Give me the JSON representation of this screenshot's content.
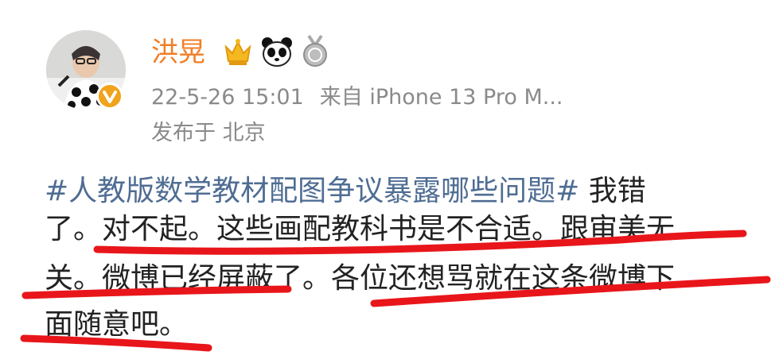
{
  "post": {
    "username": "洪晃",
    "badges": [
      "crown-badge",
      "panda-badge",
      "medal-badge"
    ],
    "timestamp": "22-5-26 15:01",
    "source": "来自 iPhone 13 Pro M...",
    "location": "发布于 北京",
    "hashtag": "#人教版数学教材配图争议暴露哪些问题#",
    "body_lines": [
      " 我错",
      "了。对不起。这些画配教科书是不合适。跟审美无",
      "关。微博已经屏蔽了。各位还想骂就在这条微博下",
      "面随意吧。"
    ]
  },
  "colors": {
    "username": "#f07e26",
    "hashtag": "#4f6d93",
    "meta": "#8a8a8a",
    "annotation": "#e8161b",
    "verified": "#f0a31b"
  }
}
